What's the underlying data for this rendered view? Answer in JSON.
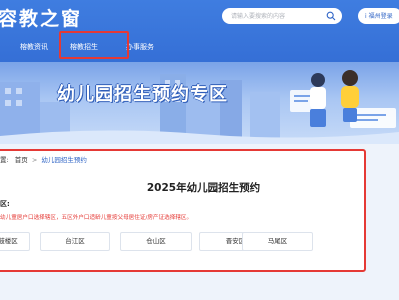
{
  "header": {
    "logo_text": "容教之窗",
    "search_placeholder": "请输入要搜索的内容",
    "login_label": "i 福州登录",
    "nav": [
      "榕教资讯",
      "榕教招生",
      "办事服务"
    ]
  },
  "banner": {
    "title": "幼儿园招生预约专区"
  },
  "breadcrumb": {
    "prefix": "置:",
    "home": "首页",
    "separator": ">",
    "current": "幼儿园招生预约"
  },
  "main": {
    "title": "2025年幼儿园招生预约",
    "district_label": "区:",
    "notice": "幼儿童居户口选择辖区，五区外户口适龄儿童按父母居住证/房产证选择辖区。",
    "districts": [
      "鼓楼区",
      "台江区",
      "仓山区",
      "晋安区",
      "马尾区"
    ]
  },
  "colors": {
    "header_blue": "#3f7de0",
    "highlight_red": "#e53935",
    "link_blue": "#2f64c6",
    "page_bg": "#eef3fb"
  }
}
